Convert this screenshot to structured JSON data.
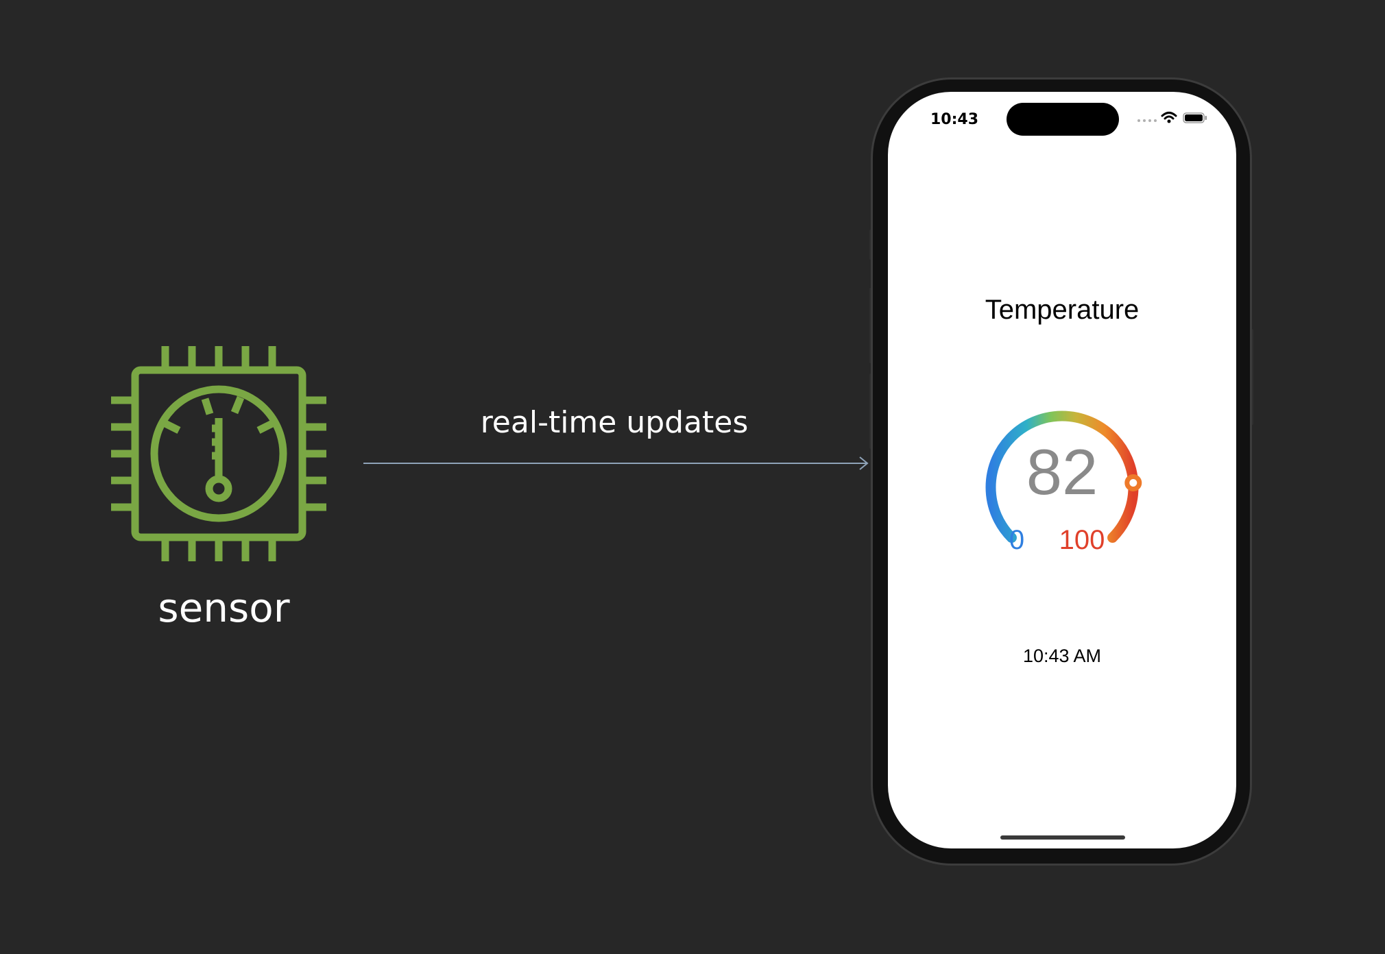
{
  "diagram": {
    "sensor_label": "sensor",
    "arrow_label": "real-time updates",
    "icon": "sensor-chip-thermometer-icon",
    "icon_color": "#7aa744",
    "arrow_color": "#8fa3b8",
    "background": "#272727"
  },
  "phone": {
    "status_time": "10:43",
    "app": {
      "title": "Temperature",
      "gauge": {
        "value": "82",
        "min_label": "0",
        "max_label": "100",
        "fraction": 0.82
      },
      "timestamp": "10:43 AM"
    },
    "icons": [
      "signal-dots-icon",
      "wifi-icon",
      "battery-icon"
    ]
  }
}
